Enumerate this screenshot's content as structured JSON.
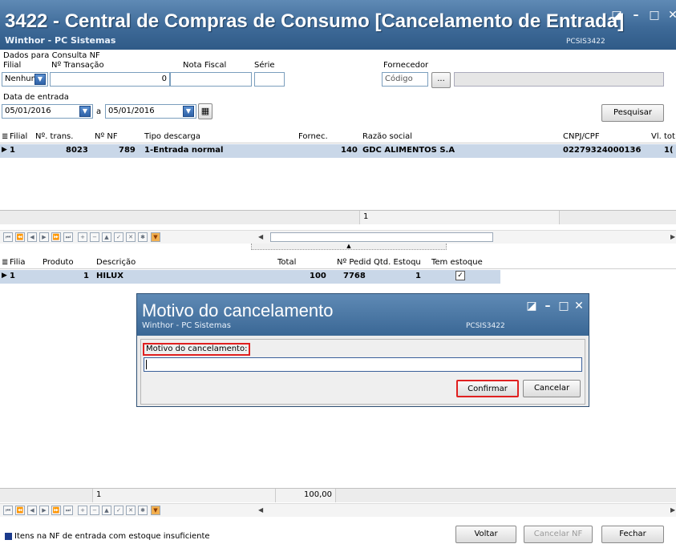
{
  "window": {
    "title": "3422 - Central de Compras de Consumo [Cancelamento de Entrada]",
    "subtitle": "Winthor - PC Sistemas",
    "code": "PCSIS3422",
    "controls": [
      "◪",
      "–",
      "□",
      "✕"
    ]
  },
  "filters": {
    "group_label": "Dados para Consulta NF",
    "filial_label": "Filial",
    "filial_value": "Nenhum",
    "transacao_label": "Nº Transação",
    "transacao_value": "0",
    "nota_label": "Nota Fiscal",
    "nota_value": "",
    "serie_label": "Série",
    "serie_value": "",
    "fornecedor_label": "Fornecedor",
    "fornecedor_placeholder": "Código",
    "ellipsis": "...",
    "data_label": "Data de entrada",
    "date_from": "05/01/2016",
    "date_sep": "a",
    "date_to": "05/01/2016",
    "search_button": "Pesquisar"
  },
  "grid1": {
    "columns": [
      "Filial",
      "Nº. trans.",
      "Nº NF",
      "Tipo descarga",
      "Fornec.",
      "Razão social",
      "CNPJ/CPF",
      "Vl. tot"
    ],
    "row": [
      "1",
      "8023",
      "789",
      "1-Entrada normal",
      "140",
      "GDC ALIMENTOS S.A",
      "02279324000136",
      "1("
    ],
    "footer_count": "1"
  },
  "grid2": {
    "columns": [
      "Filia",
      "Produto",
      "Descrição",
      "Total",
      "Nº Pedid",
      "Qtd. Estoqu",
      "Tem estoque"
    ],
    "row": [
      "1",
      "1",
      "HILUX",
      "100",
      "7768",
      "1",
      "✓"
    ],
    "footer_count": "1",
    "footer_total": "100,00"
  },
  "dialog": {
    "title": "Motivo do cancelamento",
    "subtitle": "Winthor - PC Sistemas",
    "code": "PCSIS3422",
    "field_label": "Motivo do cancelamento:",
    "field_value": "",
    "confirm": "Confirmar",
    "cancel": "Cancelar",
    "controls": [
      "◪",
      "–",
      "□",
      "✕"
    ]
  },
  "footer": {
    "legend": "Itens na NF de entrada com estoque insuficiente",
    "voltar": "Voltar",
    "cancelar_nf": "Cancelar NF",
    "fechar": "Fechar"
  },
  "colors": {
    "title_bar": "#3e6a98",
    "selected_row": "#c9d7e8",
    "highlight": "#e02020",
    "legend": "#1b3a8c"
  }
}
